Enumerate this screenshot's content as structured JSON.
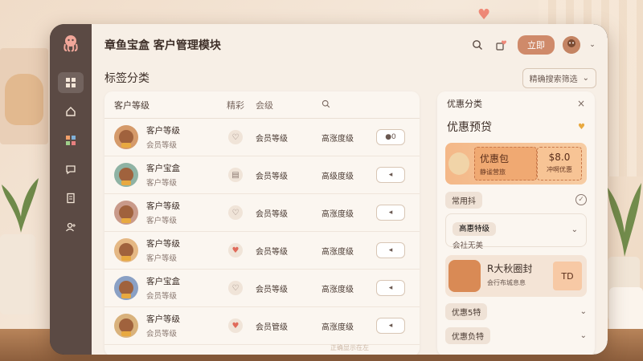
{
  "app": {
    "title": "章鱼宝盒 客户管理模块",
    "login_label": "立即",
    "home_indicator": "正确显示在左"
  },
  "page": {
    "title": "标签分类",
    "filter_label": "精确搜索筛选"
  },
  "table": {
    "headers": {
      "name": "客户等级",
      "col_a": "精彩",
      "col_b": "会级"
    },
    "rows": [
      {
        "name": "客户等级",
        "sub": "会员等级",
        "level": "会员等级",
        "status": "高涨度级",
        "action": "●0",
        "avatar_color": "#d59a6a",
        "icon": "heart-outline",
        "icon_char": "♡"
      },
      {
        "name": "客户宝盒",
        "sub": "客户等级",
        "level": "会员等级",
        "status": "高级度级",
        "action": "◂",
        "avatar_color": "#8fb3a4",
        "icon": "book",
        "icon_char": "▤"
      },
      {
        "name": "客户等级",
        "sub": "客户等级",
        "level": "会员等级",
        "status": "高涨度级",
        "action": "◂",
        "avatar_color": "#c99a8a",
        "icon": "heart-outline",
        "icon_char": "♡"
      },
      {
        "name": "客户等级",
        "sub": "客户等级",
        "level": "会员等级",
        "status": "高涨度级",
        "action": "◂",
        "avatar_color": "#e5b884",
        "icon": "heart",
        "icon_char": "♥"
      },
      {
        "name": "客户宝盒",
        "sub": "会员等级",
        "level": "会员等级",
        "status": "高涨度级",
        "action": "◂",
        "avatar_color": "#8aa0c4",
        "icon": "heart-outline",
        "icon_char": "♡"
      },
      {
        "name": "客户等级",
        "sub": "会员等级",
        "level": "会员管级",
        "status": "高涨度级",
        "action": "◂",
        "avatar_color": "#d9b27c",
        "icon": "heart",
        "icon_char": "♥"
      }
    ]
  },
  "side": {
    "header": "优惠分类",
    "close": "×",
    "title": "优惠预贷",
    "promo1": {
      "coupon_title": "优惠包",
      "coupon_sub": "静谧营旅",
      "price": "$8.0",
      "price_sub": "冲啊优惠"
    },
    "row1": {
      "chip": "常用抖"
    },
    "box1": {
      "chip": "高惠特级",
      "sub": "会社无美"
    },
    "promo2": {
      "title": "R大秋圈封",
      "sub": "会行布城息息",
      "tag": "TD"
    },
    "row2": {
      "chip": "优惠5特"
    },
    "row3": {
      "chip": "优惠负特"
    }
  },
  "colors": {
    "accent": "#cf8a6a",
    "sidebar": "#5b4a44",
    "panel": "#fbf6f0",
    "background": "#f7efe6"
  }
}
